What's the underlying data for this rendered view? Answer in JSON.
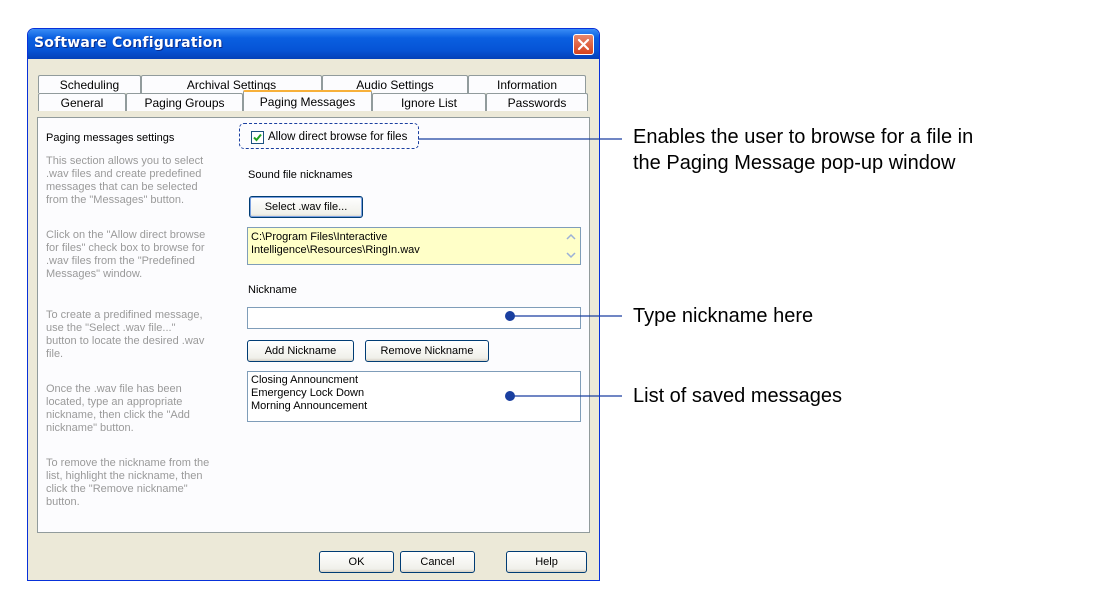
{
  "window": {
    "title": "Software Configuration"
  },
  "tabs_row1": [
    "Scheduling",
    "Archival Settings",
    "Audio Settings",
    "Information"
  ],
  "tabs_row2": [
    "General",
    "Paging Groups",
    "Paging Messages",
    "Ignore List",
    "Passwords"
  ],
  "active_tab": "Paging Messages",
  "left": {
    "heading": "Paging messages settings",
    "p1": [
      "This section allows you to select",
      ".wav files and create predefined",
      "messages that can be selected",
      "from the \"Messages\" button."
    ],
    "p2": [
      "Click on the \"Allow direct browse",
      "for files\" check box to browse for",
      ".wav files from the \"Predefined",
      "Messages\" window."
    ],
    "p3": [
      "To create a predifined message,",
      "use the \"Select .wav file...\"",
      "button to locate the desired .wav",
      "file."
    ],
    "p4": [
      "Once the .wav file has been",
      "located, type an appropriate",
      "nickname, then click the \"Add",
      "nickname\" button."
    ],
    "p5": [
      "To remove the nickname from the",
      "list, highlight the nickname, then",
      "click the \"Remove nickname\"",
      "button."
    ]
  },
  "right": {
    "allow_browse_label": "Allow direct browse for files",
    "allow_browse_checked": true,
    "sound_file_label": "Sound file nicknames",
    "select_wav_label": "Select .wav file...",
    "path_lines": [
      "C:\\Program Files\\Interactive",
      "Intelligence\\Resources\\RingIn.wav"
    ],
    "nickname_label": "Nickname",
    "nickname_value": "",
    "add_nickname_label": "Add Nickname",
    "remove_nickname_label": "Remove Nickname",
    "messages": [
      "Closing Announcment",
      "Emergency Lock Down",
      "Morning Announcement"
    ]
  },
  "buttons": {
    "ok": "OK",
    "cancel": "Cancel",
    "help": "Help"
  },
  "annotations": {
    "a1": [
      "Enables the user to browse for a file in",
      "the Paging Message pop-up window"
    ],
    "a2": "Type nickname here",
    "a3": "List of saved messages"
  }
}
